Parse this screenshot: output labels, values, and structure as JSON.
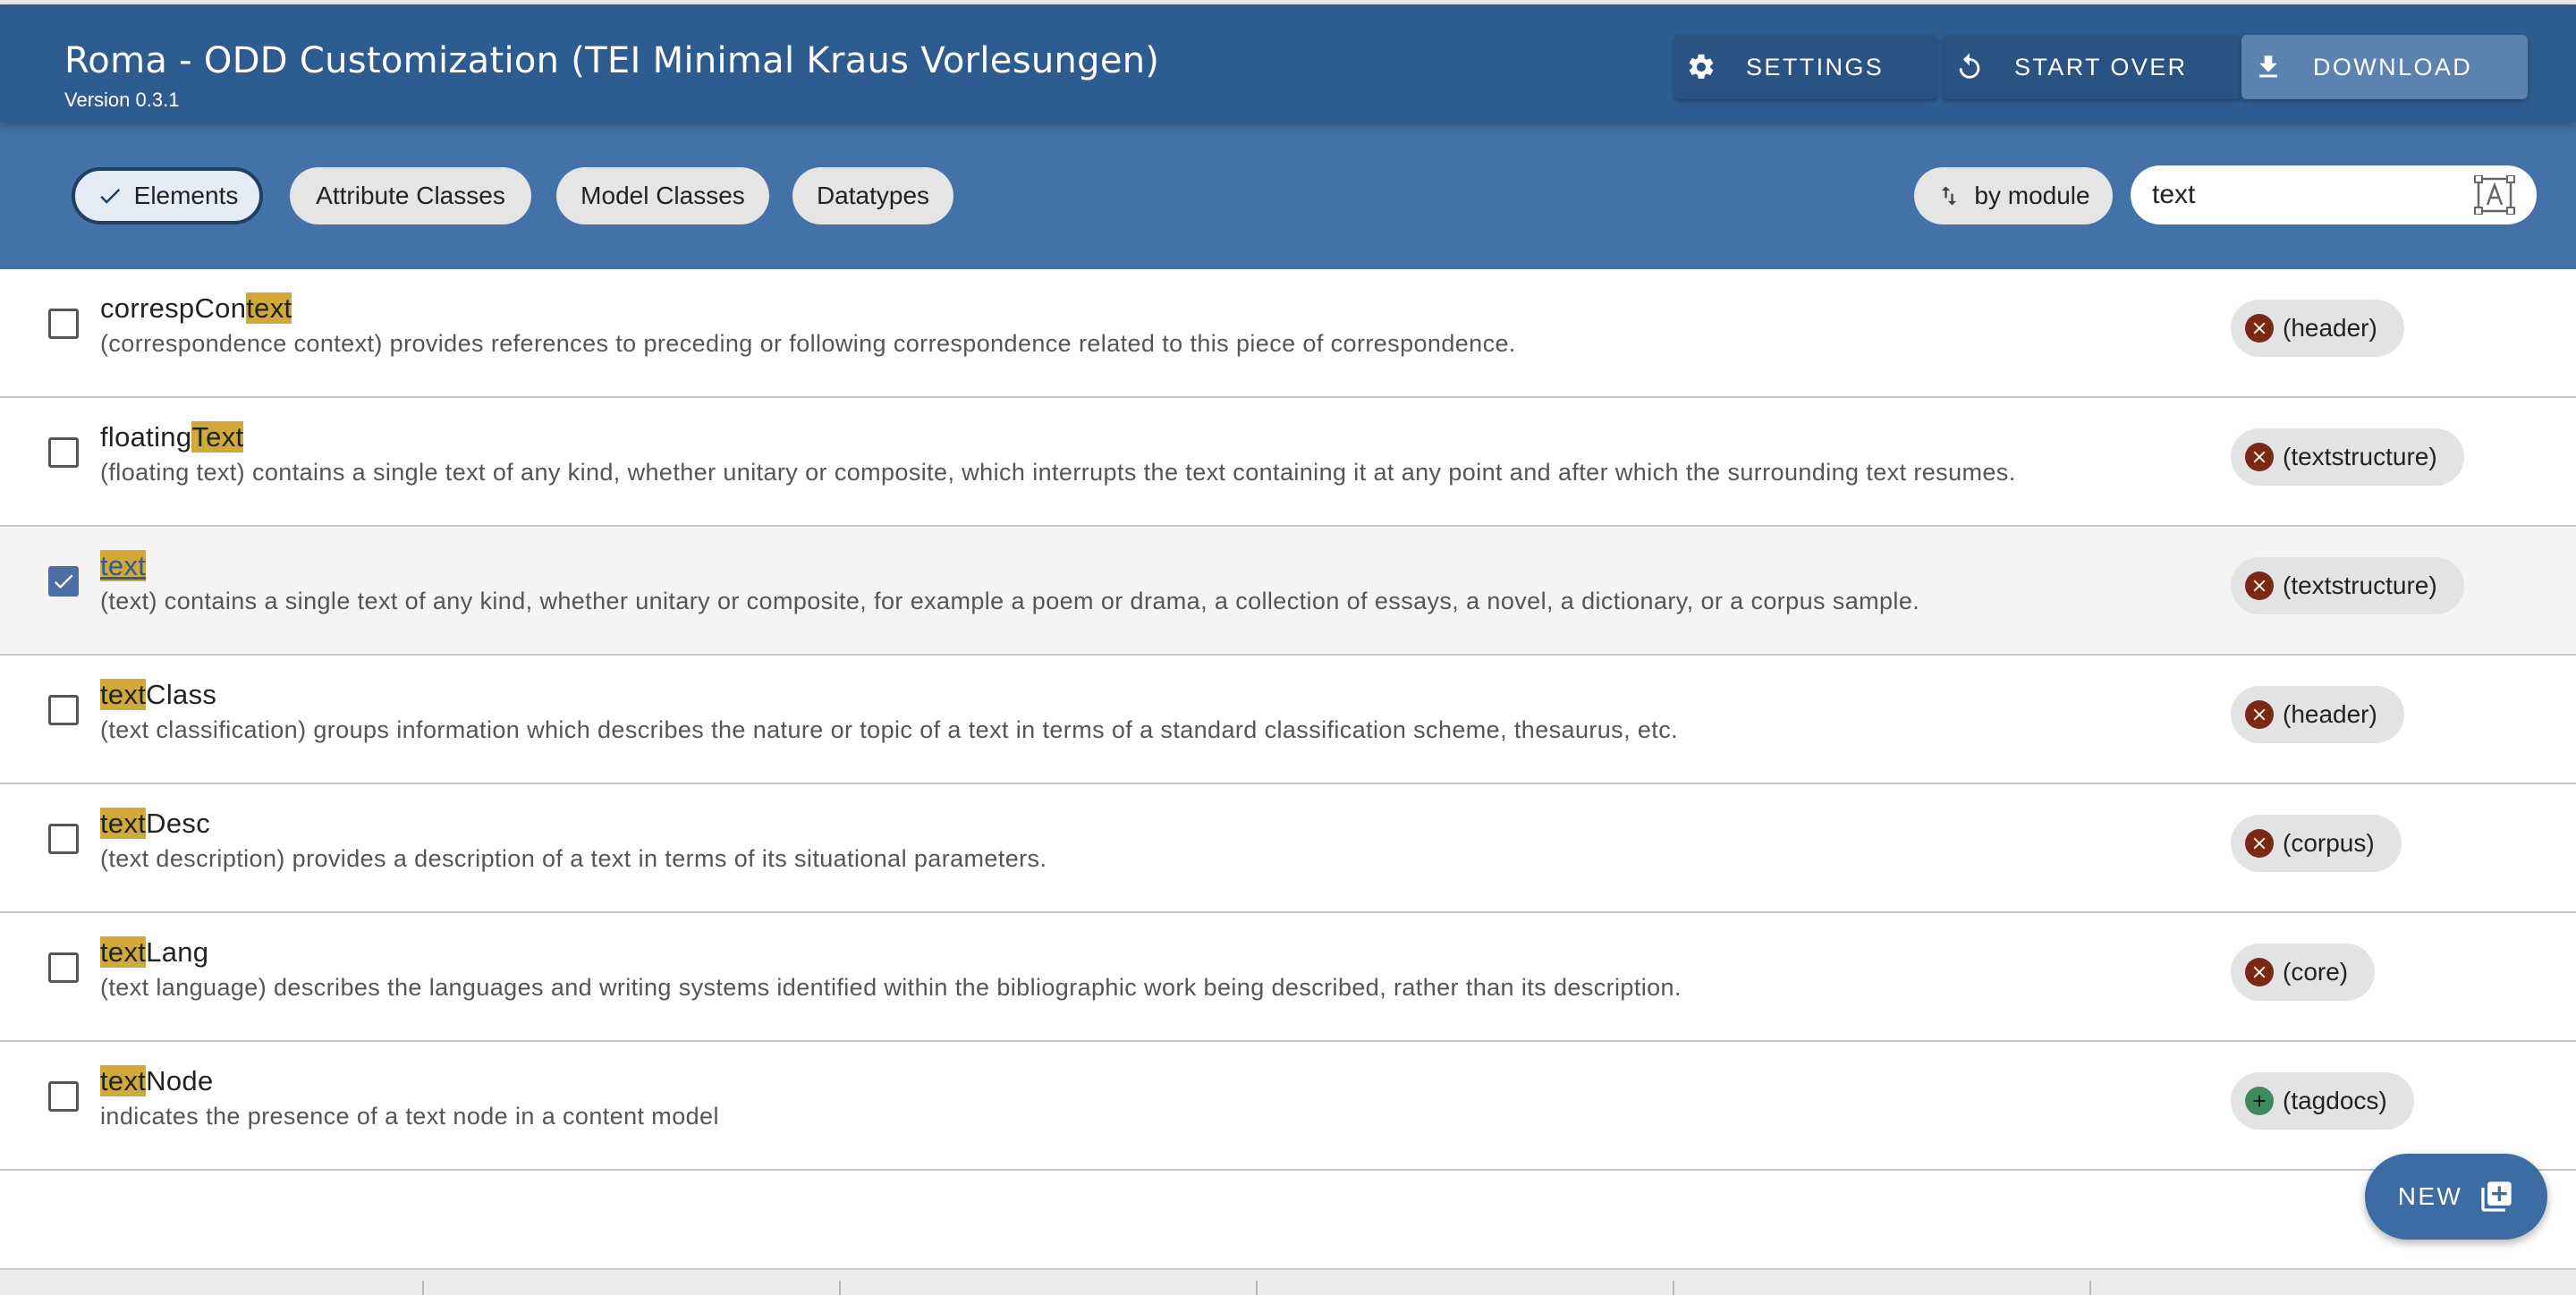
{
  "header": {
    "title": "Roma - ODD Customization (TEI Minimal Kraus Vorlesungen)",
    "version": "Version 0.3.1",
    "buttons": {
      "settings": "SETTINGS",
      "start_over": "START OVER",
      "download": "DOWNLOAD"
    },
    "icons": {
      "settings": "gear-icon",
      "start_over": "refresh-icon",
      "download": "download-icon"
    }
  },
  "filters": {
    "chips": [
      "Elements",
      "Attribute Classes",
      "Model Classes",
      "Datatypes"
    ],
    "active": "Elements",
    "sort_label": "by module",
    "search_value": "text"
  },
  "elements": [
    {
      "pre": "correspCon",
      "match": "text",
      "post": "",
      "description": "(correspondence context) provides references to preceding or following correspondence related to this piece of correspondence.",
      "module": "(header)",
      "status": "remove",
      "checked": false
    },
    {
      "pre": "floating",
      "match": "Text",
      "post": "",
      "description": "(floating text) contains a single text of any kind, whether unitary or composite, which interrupts the text containing it at any point and after which the surrounding text resumes.",
      "module": "(textstructure)",
      "status": "remove",
      "checked": false
    },
    {
      "pre": "",
      "match": "text",
      "post": "",
      "description": "(text) contains a single text of any kind, whether unitary or composite, for example a poem or drama, a collection of essays, a novel, a dictionary, or a corpus sample.",
      "module": "(textstructure)",
      "status": "remove",
      "checked": true
    },
    {
      "pre": "",
      "match": "text",
      "post": "Class",
      "description": "(text classification) groups information which describes the nature or topic of a text in terms of a standard classification scheme, thesaurus, etc.",
      "module": "(header)",
      "status": "remove",
      "checked": false
    },
    {
      "pre": "",
      "match": "text",
      "post": "Desc",
      "description": "(text description) provides a description of a text in terms of its situational parameters.",
      "module": "(corpus)",
      "status": "remove",
      "checked": false
    },
    {
      "pre": "",
      "match": "text",
      "post": "Lang",
      "description": "(text language) describes the languages and writing systems identified within the bibliographic work being described, rather than its description.",
      "module": "(core)",
      "status": "remove",
      "checked": false
    },
    {
      "pre": "",
      "match": "text",
      "post": "Node",
      "description": "indicates the presence of a text node in a content model",
      "module": "(tagdocs)",
      "status": "add",
      "checked": false
    }
  ],
  "fab": {
    "label": "NEW",
    "icon": "add-box-icon"
  },
  "colors": {
    "header": "#2e5b90",
    "filterbar": "#4472a8",
    "highlight": "#cfaa3a",
    "remove": "#7a2a13",
    "add": "#3f8a5c"
  }
}
